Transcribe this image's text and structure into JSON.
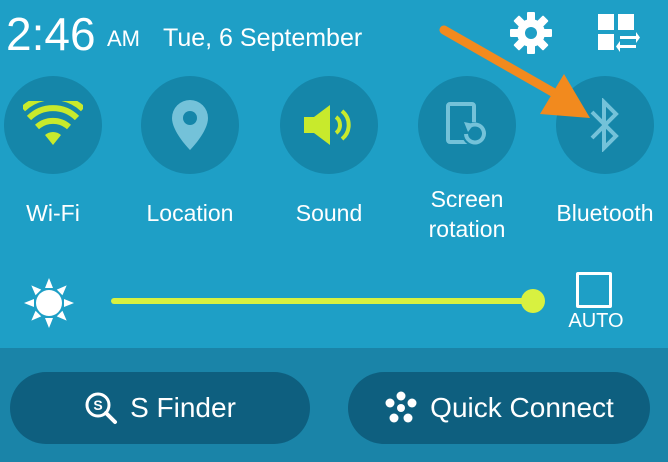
{
  "status": {
    "time": "2:46",
    "ampm": "AM",
    "date": "Tue, 6 September"
  },
  "header_icons": [
    "gear-icon",
    "grid-icon"
  ],
  "toggles": [
    {
      "label": "Wi-Fi",
      "icon": "wifi-icon",
      "active": true
    },
    {
      "label": "Location",
      "icon": "location-pin-icon",
      "active": false
    },
    {
      "label": "Sound",
      "icon": "speaker-icon",
      "active": true
    },
    {
      "label_line1": "Screen",
      "label_line2": "rotation",
      "icon": "screen-rotation-icon",
      "active": false
    },
    {
      "label": "Bluetooth",
      "icon": "bluetooth-icon",
      "active": false
    }
  ],
  "brightness": {
    "level_percent": 100,
    "auto_label": "AUTO",
    "auto_checked": false
  },
  "buttons": {
    "s_finder": "S Finder",
    "quick_connect": "Quick Connect"
  },
  "colors": {
    "panel": "#1e9fc6",
    "tile_bg": "#1586a9",
    "active": "#c8ea2c",
    "inactive": "#74c2d9",
    "slider": "#d8f140",
    "bottom_bar": "#1a84a8",
    "pill": "#0e5f7f",
    "annotation_arrow": "#f28a1e"
  }
}
